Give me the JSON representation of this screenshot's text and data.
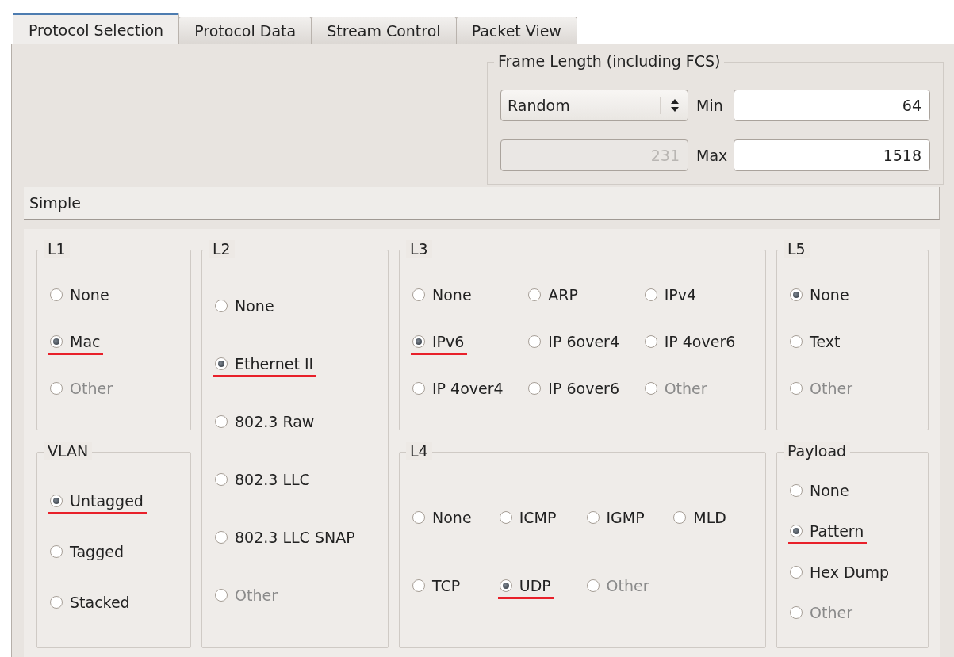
{
  "tabs": [
    {
      "label": "Protocol Selection",
      "selected": true
    },
    {
      "label": "Protocol Data",
      "selected": false
    },
    {
      "label": "Stream Control",
      "selected": false
    },
    {
      "label": "Packet View",
      "selected": false
    }
  ],
  "frame_length": {
    "title": "Frame Length (including FCS)",
    "mode": "Random",
    "average": "231",
    "min_label": "Min",
    "min": "64",
    "max_label": "Max",
    "max": "1518"
  },
  "simple_header": "Simple",
  "groups": [
    {
      "title": "L1",
      "rows": [
        [
          {
            "label": "None",
            "selected": false,
            "disabled": false,
            "underlined": false
          }
        ],
        [
          {
            "label": "Mac",
            "selected": true,
            "disabled": false,
            "underlined": true
          }
        ],
        [
          {
            "label": "Other",
            "selected": false,
            "disabled": true,
            "underlined": false
          }
        ]
      ]
    },
    {
      "title": "L2",
      "rows": [
        [
          {
            "label": "None",
            "selected": false,
            "disabled": false,
            "underlined": false
          }
        ],
        [
          {
            "label": "Ethernet II",
            "selected": true,
            "disabled": false,
            "underlined": true
          }
        ],
        [
          {
            "label": "802.3 Raw",
            "selected": false,
            "disabled": false,
            "underlined": false
          }
        ],
        [
          {
            "label": "802.3 LLC",
            "selected": false,
            "disabled": false,
            "underlined": false
          }
        ],
        [
          {
            "label": "802.3 LLC SNAP",
            "selected": false,
            "disabled": false,
            "underlined": false
          }
        ],
        [
          {
            "label": "Other",
            "selected": false,
            "disabled": true,
            "underlined": false
          }
        ]
      ]
    },
    {
      "title": "L3",
      "rows": [
        [
          {
            "label": "None",
            "selected": false,
            "disabled": false,
            "underlined": false
          },
          {
            "label": "ARP",
            "selected": false,
            "disabled": false,
            "underlined": false
          },
          {
            "label": "IPv4",
            "selected": false,
            "disabled": false,
            "underlined": false
          }
        ],
        [
          {
            "label": "IPv6",
            "selected": true,
            "disabled": false,
            "underlined": true
          },
          {
            "label": "IP 6over4",
            "selected": false,
            "disabled": false,
            "underlined": false
          },
          {
            "label": "IP 4over6",
            "selected": false,
            "disabled": false,
            "underlined": false
          }
        ],
        [
          {
            "label": "IP 4over4",
            "selected": false,
            "disabled": false,
            "underlined": false
          },
          {
            "label": "IP 6over6",
            "selected": false,
            "disabled": false,
            "underlined": false
          },
          {
            "label": "Other",
            "selected": false,
            "disabled": true,
            "underlined": false
          }
        ]
      ]
    },
    {
      "title": "L5",
      "rows": [
        [
          {
            "label": "None",
            "selected": true,
            "disabled": false,
            "underlined": false
          }
        ],
        [
          {
            "label": "Text",
            "selected": false,
            "disabled": false,
            "underlined": false
          }
        ],
        [
          {
            "label": "Other",
            "selected": false,
            "disabled": true,
            "underlined": false
          }
        ]
      ]
    },
    {
      "title": "VLAN",
      "rows": [
        [
          {
            "label": "Untagged",
            "selected": true,
            "disabled": false,
            "underlined": true
          }
        ],
        [
          {
            "label": "Tagged",
            "selected": false,
            "disabled": false,
            "underlined": false
          }
        ],
        [
          {
            "label": "Stacked",
            "selected": false,
            "disabled": false,
            "underlined": false
          }
        ]
      ]
    },
    {
      "title": "L4",
      "rows": [
        [
          {
            "label": "None",
            "selected": false,
            "disabled": false,
            "underlined": false
          },
          {
            "label": "ICMP",
            "selected": false,
            "disabled": false,
            "underlined": false
          },
          {
            "label": "IGMP",
            "selected": false,
            "disabled": false,
            "underlined": false
          },
          {
            "label": "MLD",
            "selected": false,
            "disabled": false,
            "underlined": false
          }
        ],
        [
          {
            "label": "TCP",
            "selected": false,
            "disabled": false,
            "underlined": false
          },
          {
            "label": "UDP",
            "selected": true,
            "disabled": false,
            "underlined": true
          },
          {
            "label": "Other",
            "selected": false,
            "disabled": true,
            "underlined": false
          }
        ]
      ]
    },
    {
      "title": "Payload",
      "rows": [
        [
          {
            "label": "None",
            "selected": false,
            "disabled": false,
            "underlined": false
          }
        ],
        [
          {
            "label": "Pattern",
            "selected": true,
            "disabled": false,
            "underlined": true
          }
        ],
        [
          {
            "label": "Hex Dump",
            "selected": false,
            "disabled": false,
            "underlined": false
          }
        ],
        [
          {
            "label": "Other",
            "selected": false,
            "disabled": true,
            "underlined": false
          }
        ]
      ]
    }
  ]
}
